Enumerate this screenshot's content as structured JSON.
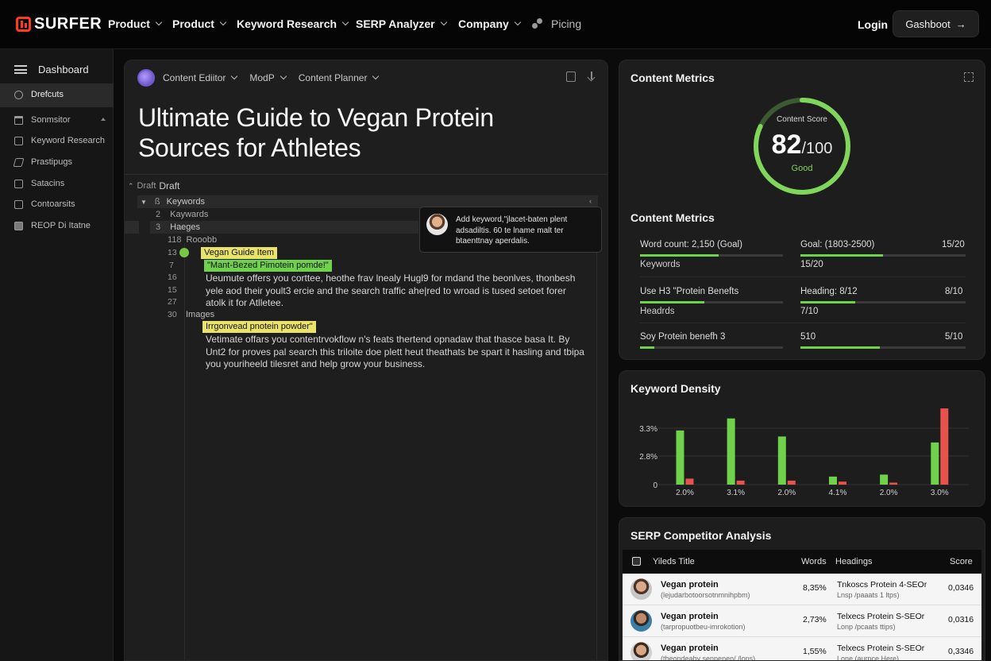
{
  "nav": {
    "logo": "SURFER",
    "items": [
      "Product",
      "Product",
      "Keyword Research",
      "SERP Analyzer",
      "Company"
    ],
    "pricing": "Picing",
    "login": "Login",
    "cta": "Gashboot",
    "cta_arrow": "→"
  },
  "sidebar": {
    "header": "Dashboard",
    "items": [
      "Drefcuts",
      "Sonmsitor",
      "Keyword Research",
      "Prastipugs",
      "Satacins",
      "Contoarsits",
      "REOP Di Itatne"
    ]
  },
  "editor": {
    "tabs": [
      "Content Ediitor",
      "ModP",
      "Content Planner"
    ],
    "title": "Ultimate Guide to Vegan Protein Sources for Athletes",
    "outline_root_prefix": "Draft",
    "outline_root": "Draft",
    "rows": [
      {
        "no": "ß",
        "text": "Keywords"
      },
      {
        "no": "2",
        "text": "Kaywards"
      },
      {
        "no": "3",
        "text": "Haeges"
      },
      {
        "no": "118",
        "text": "Rooobb"
      }
    ],
    "line_numbers": [
      "13",
      "7",
      "16",
      "15",
      "27",
      "30"
    ],
    "highlight_1": "Vegan Guide Item",
    "highlight_2": "\"Mant-Bezed Pimotein pomde!\"",
    "para_1": "Ueumute offers you corttee, heothe frav lnealy Hugl9 for mdand the beonlves, thonbesh yele aod their yoult3 ercie and the search traffic ahe|red to wroad is tused setoet forer atolk it for Atlletee.",
    "images_label": "Images",
    "highlight_3": "Irrgonvead pnotein powder\"",
    "para_2": "Vetimate offars you contentrvokflow n's feats thertend opnadaw that thasce basa It. By Unt2 for proves pal search this triloite doe plett heut theathats be spart it hasling and tbipa you youriheeld tilesret and help grow your business.",
    "tooltip": "Add keyword,\"jlacet-baten plent adsadiltis. 60 te lname malt ter btaenttnay aperdalis."
  },
  "score_panel": {
    "title": "Content Metrics",
    "gauge_label": "Content Score",
    "score": "82",
    "score_max": "/100",
    "score_value": 0.82,
    "grade": "Good",
    "metrics_title": "Content Metrics",
    "metrics": [
      {
        "left_label": "Word count: 2,150 (Goal)",
        "left_sub": "Keywords",
        "left_fill": 0.55,
        "right_label": "Goal: (1803-2500)",
        "right_value": "15/20",
        "right_sub": "15/20",
        "right_fill": 0.5
      },
      {
        "left_label": "Use H3 \"Protein Benefts",
        "left_sub": "Headrds",
        "left_fill": 0.45,
        "right_label": "Heading: 8/12",
        "right_value": "8/10",
        "right_sub": "7/10",
        "right_fill": 0.33
      },
      {
        "left_label": "Soy Protein  benefh  3",
        "left_sub": "",
        "left_fill": 0.1,
        "right_label": "510",
        "right_value": "5/10",
        "right_sub": "",
        "right_fill": 0.48
      }
    ]
  },
  "density_panel": {
    "title": "Keyword Density"
  },
  "chart_data": {
    "type": "bar",
    "title": "Keyword Density",
    "categories": [
      "2.0%",
      "3.1%",
      "2.0%",
      "4.1%",
      "2.0%",
      "3.0%"
    ],
    "y_tick_labels": [
      "3.3%",
      "2.8%",
      "0"
    ],
    "series": [
      {
        "color": "#6fd14c",
        "values": [
          2.7,
          3.3,
          2.4,
          0.4,
          0.5,
          2.1
        ]
      },
      {
        "color": "#e5534b",
        "values": [
          0.3,
          0.2,
          0.2,
          0.15,
          0.1,
          3.8
        ]
      }
    ],
    "ylim": [
      0,
      4.0
    ],
    "grid": true
  },
  "serp_panel": {
    "title": "SERP Competitor Analysis",
    "headers": [
      "Yileds Title",
      "Words",
      "Headings",
      "Score"
    ],
    "rows": [
      {
        "title": "Vegan protein",
        "sub": "(lejudarbotoorsotnmnihpbm)",
        "words": "8,35%",
        "heading": "Tnkoscs Protein 4-SEOr",
        "heading_sub": "Lnsp /paaats 1 ltps)",
        "score": "0,0346",
        "avatar": "#c79a7a"
      },
      {
        "title": "Vegan protein",
        "sub": "(tarpropuotbeu-imrokotion)",
        "words": "2,73%",
        "heading": "Telxecs Protein S-SEOr",
        "heading_sub": "Lonp /pcaats ttips)",
        "score": "0,0316",
        "avatar": "#8a6a52"
      },
      {
        "title": "Vegan protein",
        "sub": "(theondeaby senpenen/ /lops)",
        "words": "1,55%",
        "heading": "Telxecs Protein S-SEOr",
        "heading_sub": "Lone (aurpce Here)",
        "score": "0,3346",
        "avatar": "#b58a6a"
      }
    ]
  }
}
